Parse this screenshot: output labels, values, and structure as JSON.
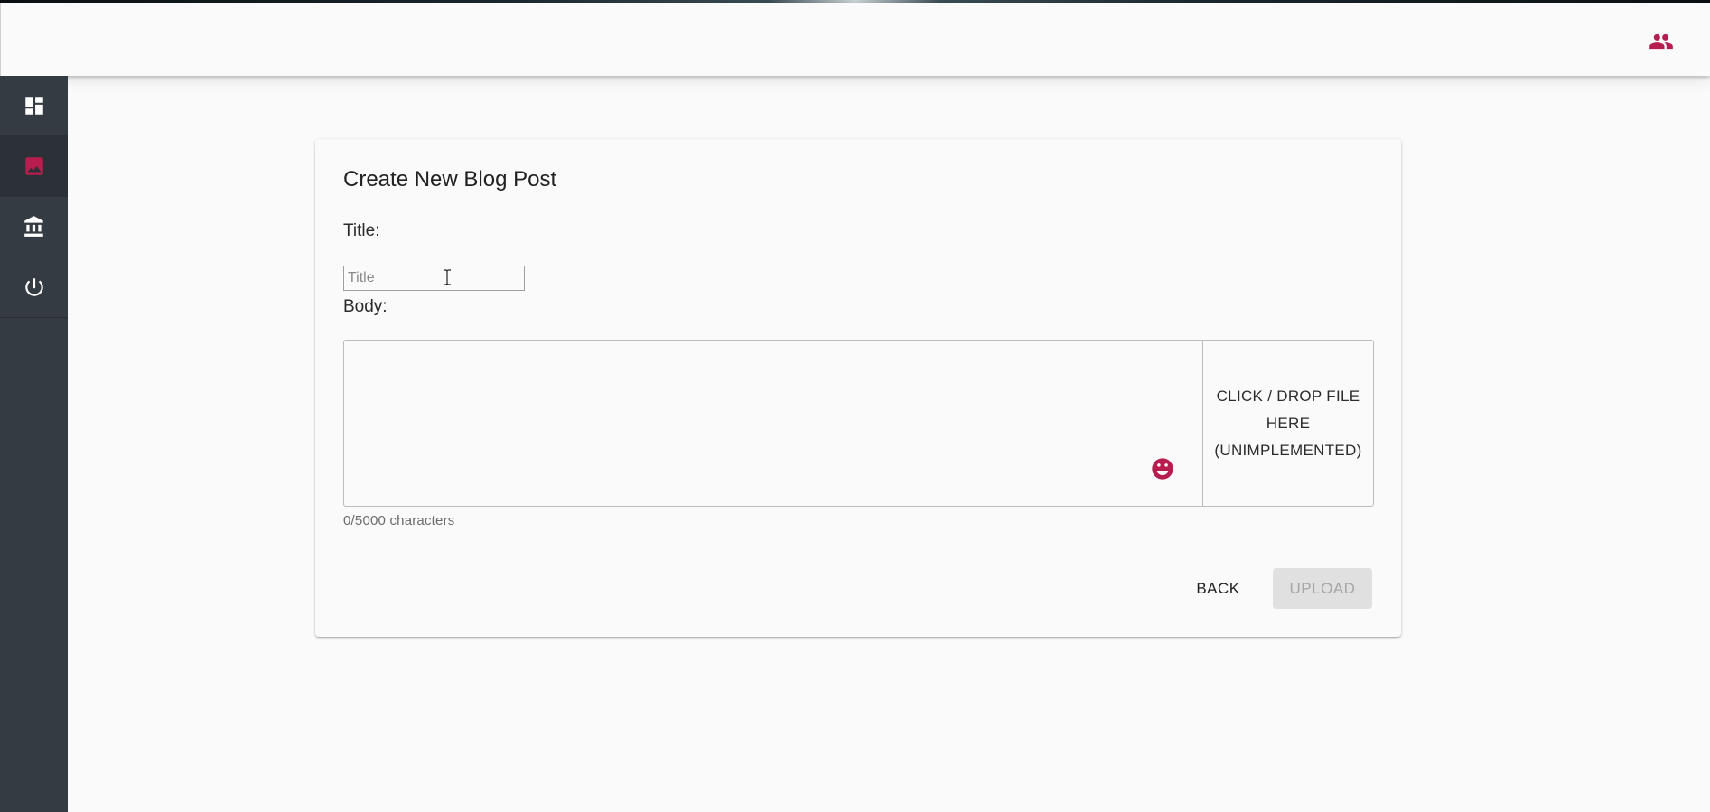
{
  "colors": {
    "accent": "#b71d4f",
    "sidebar_bg": "#353b42",
    "sidebar_icon": "#ffffff",
    "page_bg": "#fafafa"
  },
  "appbar": {
    "account_icon": "people-icon"
  },
  "sidebar": {
    "items": [
      {
        "icon": "dashboard-icon",
        "active": false
      },
      {
        "icon": "image-icon",
        "active": true
      },
      {
        "icon": "bank-icon",
        "active": false
      },
      {
        "icon": "power-icon",
        "active": false
      }
    ]
  },
  "form": {
    "heading": "Create New Blog Post",
    "title_label": "Title:",
    "title_placeholder": "Title",
    "title_value": "",
    "body_label": "Body:",
    "body_value": "",
    "dropzone_text": "CLICK / DROP FILE HERE (UNIMPLEMENTED)",
    "char_count": "0/5000 characters",
    "back_label": "BACK",
    "upload_label": "UPLOAD",
    "upload_disabled": true
  }
}
